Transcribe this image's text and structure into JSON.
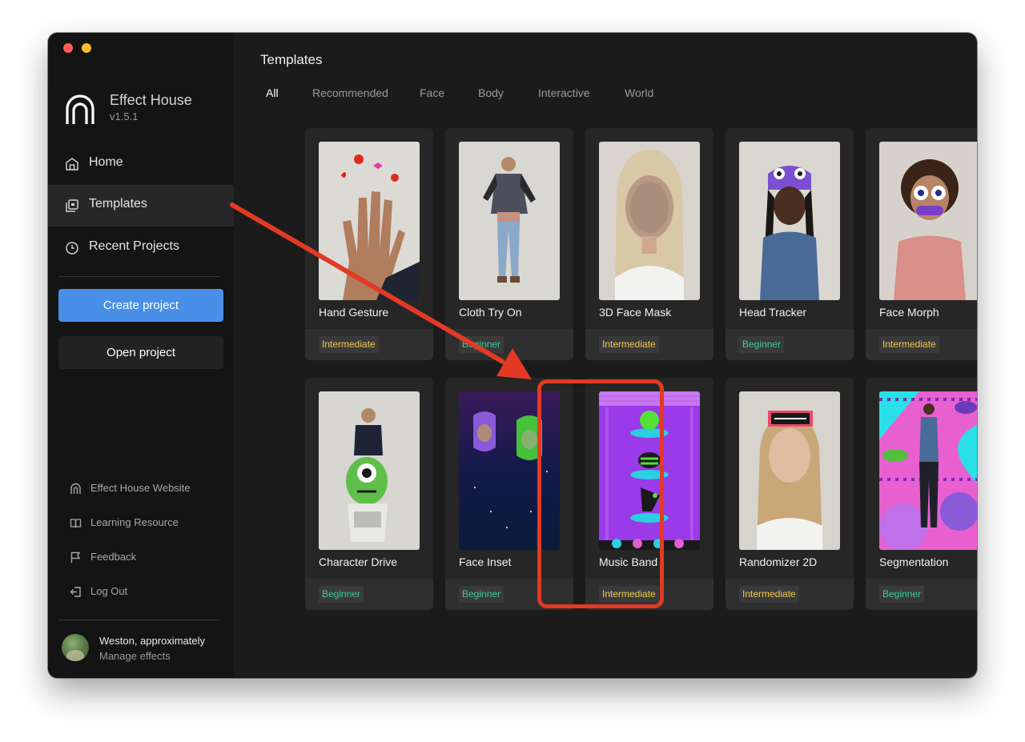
{
  "app": {
    "name": "Effect House",
    "version": "v1.5.1"
  },
  "sidebar": {
    "nav": [
      {
        "label": "Home",
        "icon": "home-icon"
      },
      {
        "label": "Templates",
        "icon": "templates-icon",
        "active": true
      },
      {
        "label": "Recent Projects",
        "icon": "clock-icon"
      }
    ],
    "create_label": "Create project",
    "open_label": "Open project",
    "links": [
      {
        "label": "Effect House Website",
        "icon": "website-icon"
      },
      {
        "label": "Learning Resource",
        "icon": "book-icon"
      },
      {
        "label": "Feedback",
        "icon": "flag-icon"
      },
      {
        "label": "Log Out",
        "icon": "logout-icon"
      }
    ],
    "user": {
      "name": "Weston, approximately",
      "subtitle": "Manage effects"
    }
  },
  "main": {
    "title": "Templates",
    "tabs": [
      "All",
      "Recommended",
      "Face",
      "Body",
      "Interactive",
      "World"
    ],
    "active_tab": "All",
    "templates": [
      {
        "title": "Hand Gesture",
        "level": "Intermediate"
      },
      {
        "title": "Cloth Try On",
        "level": "Beginner"
      },
      {
        "title": "3D Face Mask",
        "level": "Intermediate"
      },
      {
        "title": "Head Tracker",
        "level": "Beginner"
      },
      {
        "title": "Face Morph",
        "level": "Intermediate"
      },
      {
        "title": "Character Drive",
        "level": "Beginner"
      },
      {
        "title": "Face Inset",
        "level": "Beginner"
      },
      {
        "title": "Music Band",
        "level": "Intermediate",
        "highlighted": true
      },
      {
        "title": "Randomizer 2D",
        "level": "Intermediate"
      },
      {
        "title": "Segmentation",
        "level": "Beginner"
      }
    ]
  },
  "colors": {
    "accent": "#4a8fe7",
    "intermediate": "#f2c94c",
    "beginner": "#3ec99a",
    "annotation": "#e23a25"
  }
}
